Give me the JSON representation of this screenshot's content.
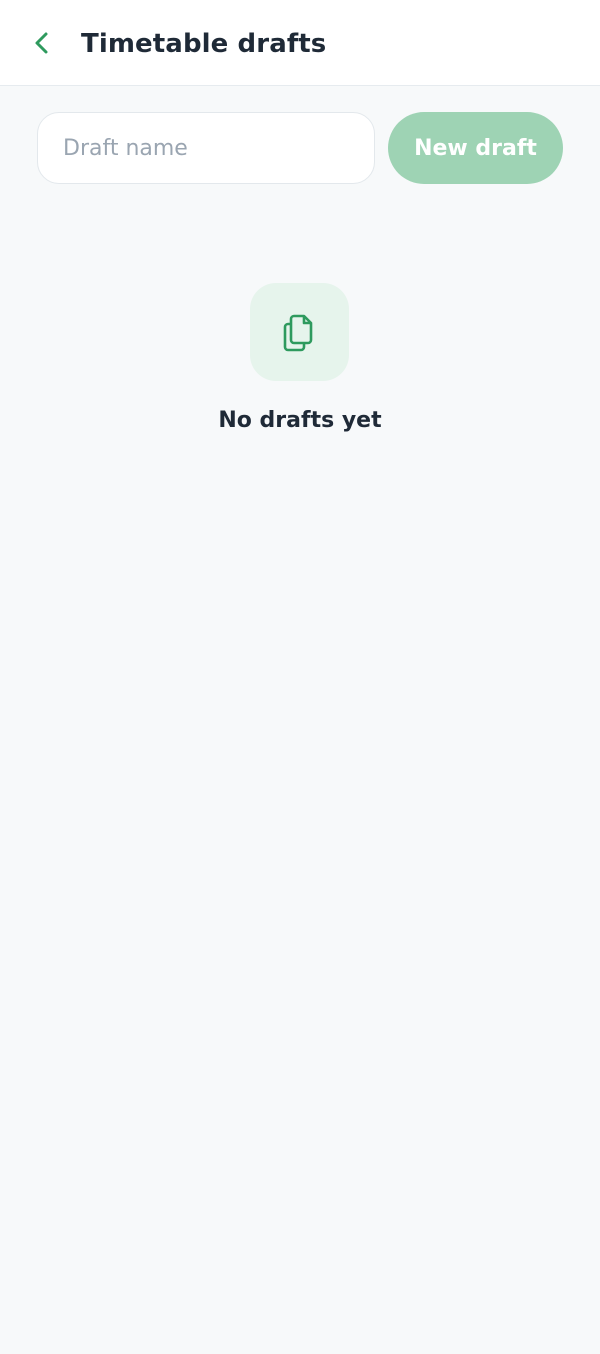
{
  "header": {
    "title": "Timetable drafts",
    "back_icon": "chevron-left-icon"
  },
  "form": {
    "input_placeholder": "Draft name",
    "input_value": "",
    "new_button_label": "New draft"
  },
  "empty_state": {
    "icon": "documents-icon",
    "message": "No drafts yet"
  },
  "colors": {
    "accent": "#2e9a5e",
    "button_bg": "#9ed3b4",
    "icon_bg": "#e6f4ec",
    "page_bg": "#f7f9fa",
    "title_text": "#1f2a37"
  }
}
